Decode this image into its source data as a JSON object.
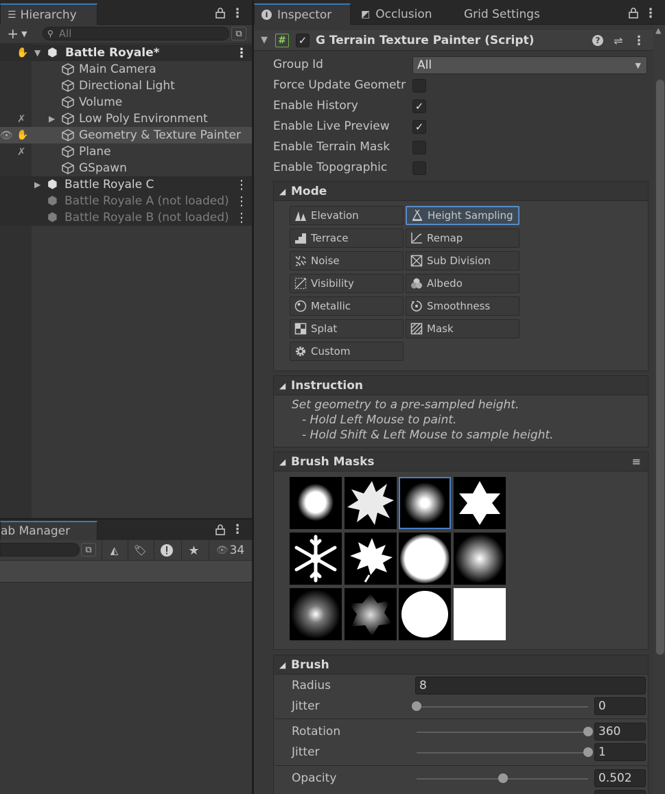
{
  "hierarchy": {
    "tab_label": "Hierarchy",
    "search_placeholder": "All",
    "rows": [
      {
        "label": "Battle Royale*",
        "type": "scene"
      },
      {
        "label": "Main Camera",
        "type": "object"
      },
      {
        "label": "Directional Light",
        "type": "object"
      },
      {
        "label": "Volume",
        "type": "object"
      },
      {
        "label": "Low Poly Environment",
        "type": "object"
      },
      {
        "label": "Geometry & Texture Painter",
        "type": "object",
        "selected": true
      },
      {
        "label": "Plane",
        "type": "object"
      },
      {
        "label": "GSpawn",
        "type": "object"
      },
      {
        "label": "Battle Royale C",
        "type": "scene"
      },
      {
        "label": "Battle Royale A (not loaded)",
        "type": "scene-unloaded"
      },
      {
        "label": "Battle Royale B (not loaded)",
        "type": "scene-unloaded"
      }
    ]
  },
  "prefab_manager": {
    "tab_label": "ab Manager",
    "count": "34"
  },
  "inspector": {
    "tabs": [
      "Inspector",
      "Occlusion",
      "Grid Settings"
    ],
    "component_title": "G Terrain Texture Painter (Script)",
    "component_icon": "#",
    "props": [
      {
        "label": "Group Id",
        "type": "dropdown",
        "value": "All"
      },
      {
        "label": "Force Update Geometr",
        "type": "checkbox",
        "checked": false
      },
      {
        "label": "Enable History",
        "type": "checkbox",
        "checked": true
      },
      {
        "label": "Enable Live Preview",
        "type": "checkbox",
        "checked": true
      },
      {
        "label": "Enable Terrain Mask",
        "type": "checkbox",
        "checked": false
      },
      {
        "label": "Enable Topographic",
        "type": "checkbox",
        "checked": false
      }
    ],
    "mode": {
      "title": "Mode",
      "buttons": [
        {
          "label": "Elevation",
          "icon": "elevation-icon"
        },
        {
          "label": "Height Sampling",
          "icon": "height-sampling-icon",
          "selected": true
        },
        {
          "label": "Terrace",
          "icon": "terrace-icon"
        },
        {
          "label": "Remap",
          "icon": "remap-icon"
        },
        {
          "label": "Noise",
          "icon": "noise-icon"
        },
        {
          "label": "Sub Division",
          "icon": "sub-division-icon"
        },
        {
          "label": "Visibility",
          "icon": "visibility-icon"
        },
        {
          "label": "Albedo",
          "icon": "albedo-icon"
        },
        {
          "label": "Metallic",
          "icon": "metallic-icon"
        },
        {
          "label": "Smoothness",
          "icon": "smoothness-icon"
        },
        {
          "label": "Splat",
          "icon": "splat-icon"
        },
        {
          "label": "Mask",
          "icon": "mask-icon"
        },
        {
          "label": "Custom",
          "icon": "gear-icon"
        }
      ]
    },
    "instruction": {
      "title": "Instruction",
      "lines": [
        "Set geometry to a pre-sampled height.",
        "- Hold Left Mouse to paint.",
        "- Hold Shift & Left Mouse to sample height."
      ]
    },
    "brush_masks": {
      "title": "Brush Masks",
      "selected_index": 2
    },
    "brush": {
      "title": "Brush",
      "radius_label": "Radius",
      "radius": "8",
      "jitter_label": "Jitter",
      "radius_jitter": "0",
      "radius_jitter_level": 0,
      "rotation_label": "Rotation",
      "rotation": "360",
      "rotation_level": 1,
      "rotation_jitter_label": "Jitter",
      "rotation_jitter": "1",
      "rotation_jitter_level": 1,
      "opacity_label": "Opacity",
      "opacity": "0.502",
      "opacity_level": 0.502
    }
  }
}
